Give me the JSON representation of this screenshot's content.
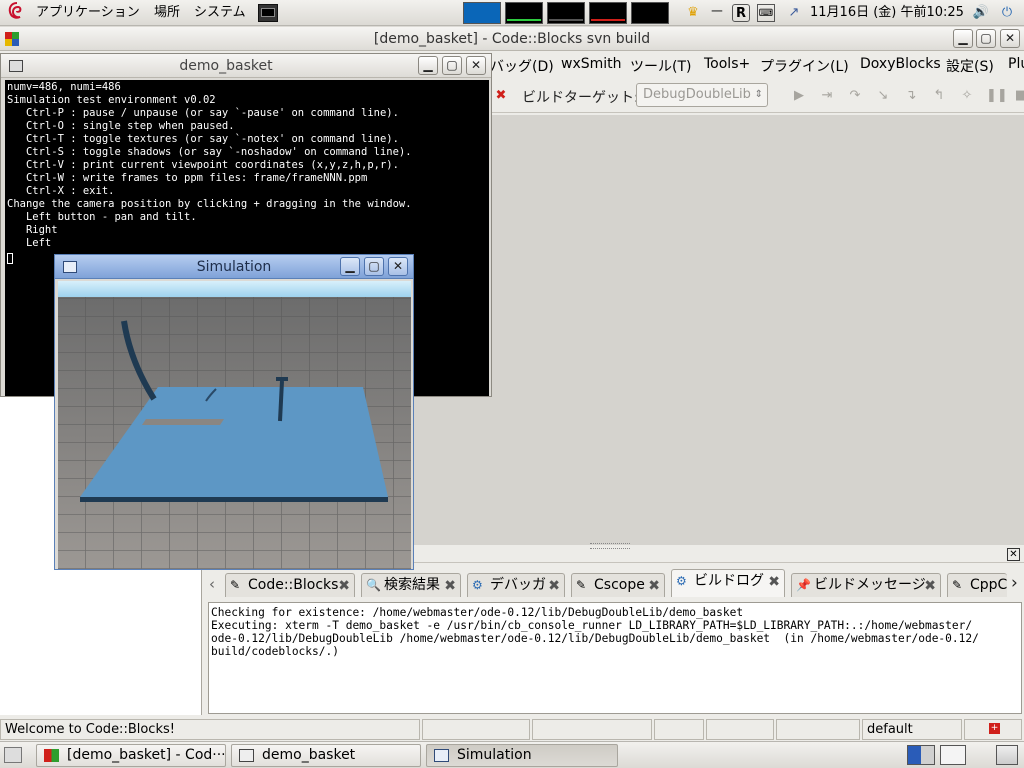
{
  "top_panel": {
    "menus": [
      "アプリケーション",
      "場所",
      "システム"
    ],
    "clock": "11月16日 (金) 午前10:25",
    "tray_r": "R",
    "workspace_colors": [
      "#0a66b8",
      "#000000",
      "#000000",
      "#000000",
      "#000000"
    ],
    "workspace_bar_colors": [
      "#0a66b8",
      "#2ecc40",
      "#555555",
      "#d0201a",
      "#000000"
    ]
  },
  "codeblocks": {
    "title": "[demo_basket] - Code::Blocks svn build",
    "menu": [
      "バッグ(D)",
      "wxSmith",
      "ツール(T)",
      "Tools+",
      "プラグイン(L)",
      "DoxyBlocks",
      "設定(S)",
      "Plu"
    ],
    "build_target_label": "ビルドターゲット:",
    "build_target_value": "DebugDoubleLib",
    "logs_tabs": [
      "Code::Blocks",
      "検索結果",
      "デバッガ",
      "Cscope",
      "ビルドログ",
      "ビルドメッセージ",
      "CppC"
    ],
    "active_tab_index": 4,
    "log_lines": [
      "Checking for existence: /home/webmaster/ode-0.12/lib/DebugDoubleLib/demo_basket",
      "Executing: xterm -T demo_basket -e /usr/bin/cb_console_runner LD_LIBRARY_PATH=$LD_LIBRARY_PATH:.:/home/webmaster/",
      "ode-0.12/lib/DebugDoubleLib /home/webmaster/ode-0.12/lib/DebugDoubleLib/demo_basket  (in /home/webmaster/ode-0.12/",
      "build/codeblocks/.)"
    ],
    "status_text": "Welcome to Code::Blocks!",
    "status_default": "default"
  },
  "terminal": {
    "title": "demo_basket",
    "lines": [
      "numv=486, numi=486",
      "",
      "Simulation test environment v0.02",
      "   Ctrl-P : pause / unpause (or say `-pause' on command line).",
      "   Ctrl-O : single step when paused.",
      "   Ctrl-T : toggle textures (or say `-notex' on command line).",
      "   Ctrl-S : toggle shadows (or say `-noshadow' on command line).",
      "   Ctrl-V : print current viewpoint coordinates (x,y,z,h,p,r).",
      "   Ctrl-W : write frames to ppm files: frame/frameNNN.ppm",
      "   Ctrl-X : exit.",
      "",
      "Change the camera position by clicking + dragging in the window.",
      "   Left button - pan and tilt.",
      "   Right",
      "   Left"
    ]
  },
  "simulation": {
    "title": "Simulation"
  },
  "taskbar": {
    "tasks": [
      "[demo_basket] - Cod···",
      "demo_basket",
      "Simulation"
    ],
    "active_index": 2
  }
}
